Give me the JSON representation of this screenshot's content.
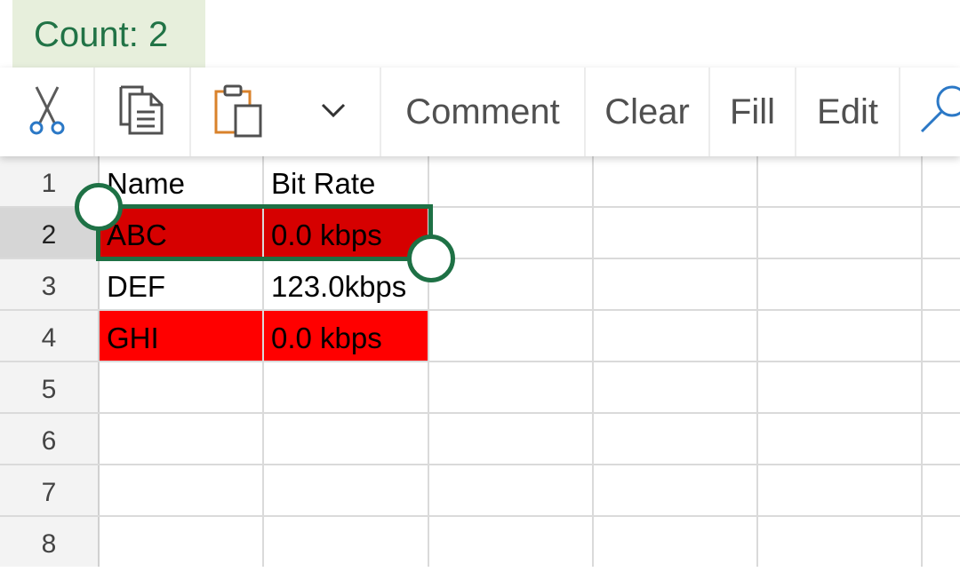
{
  "status": {
    "count_label": "Count: 2"
  },
  "toolbar": {
    "cut_icon": "scissors-icon",
    "copy_icon": "copy-icon",
    "paste_icon": "clipboard-paste-icon",
    "more_icon": "chevron-down-icon",
    "comment_label": "Comment",
    "clear_label": "Clear",
    "fill_label": "Fill",
    "edit_label": "Edit",
    "find_icon": "search-icon"
  },
  "sheet": {
    "rows": [
      {
        "num": "1",
        "a": "Name",
        "b": "Bit Rate"
      },
      {
        "num": "2",
        "a": "ABC",
        "b": "0.0 kbps"
      },
      {
        "num": "3",
        "a": "DEF",
        "b": "123.0kbps"
      },
      {
        "num": "4",
        "a": "GHI",
        "b": "0.0 kbps"
      },
      {
        "num": "5",
        "a": "",
        "b": ""
      },
      {
        "num": "6",
        "a": "",
        "b": ""
      },
      {
        "num": "7",
        "a": "",
        "b": ""
      },
      {
        "num": "8",
        "a": "",
        "b": ""
      }
    ],
    "selected_row": "2",
    "selection": "A2:B2"
  },
  "colors": {
    "accent_green": "#1e7145",
    "count_text": "#217346",
    "count_bg": "#e7efdc",
    "highlight_red": "#ff0000",
    "highlight_red_selected": "#d60000"
  }
}
